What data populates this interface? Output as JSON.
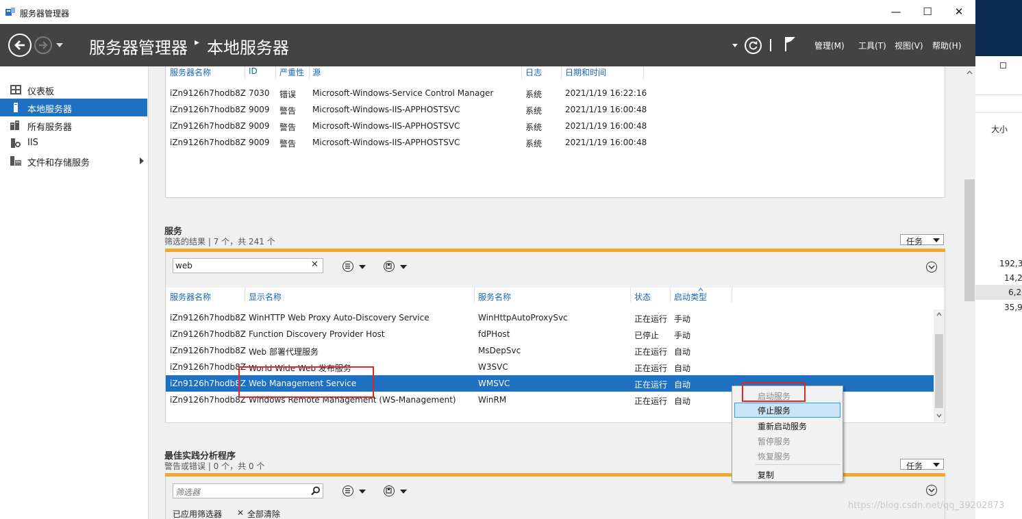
{
  "window": {
    "title": "服务器管理器",
    "minimize": "—",
    "maximize": "☐",
    "close": "✕"
  },
  "header": {
    "breadcrumb_root": "服务器管理器",
    "breadcrumb_sep": "▸",
    "breadcrumb_current": "本地服务器",
    "menus": [
      "管理(M)",
      "工具(T)",
      "视图(V)",
      "帮助(H)"
    ]
  },
  "sidebar": {
    "items": [
      {
        "label": "仪表板",
        "icon": "dashboard-icon"
      },
      {
        "label": "本地服务器",
        "icon": "server-icon",
        "active": true
      },
      {
        "label": "所有服务器",
        "icon": "servers-icon"
      },
      {
        "label": "IIS",
        "icon": "iis-icon"
      },
      {
        "label": "文件和存储服务",
        "icon": "storage-icon",
        "has_arrow": true
      }
    ]
  },
  "events": {
    "columns": [
      "服务器名称",
      "ID",
      "严重性",
      "源",
      "日志",
      "日期和时间"
    ],
    "rows": [
      [
        "iZn9126h7hodb8Z",
        "7030",
        "错误",
        "Microsoft-Windows-Service Control Manager",
        "系统",
        "2021/1/19 16:22:16"
      ],
      [
        "iZn9126h7hodb8Z",
        "9009",
        "警告",
        "Microsoft-Windows-IIS-APPHOSTSVC",
        "系统",
        "2021/1/19 16:00:48"
      ],
      [
        "iZn9126h7hodb8Z",
        "9009",
        "警告",
        "Microsoft-Windows-IIS-APPHOSTSVC",
        "系统",
        "2021/1/19 16:00:48"
      ],
      [
        "iZn9126h7hodb8Z",
        "9009",
        "警告",
        "Microsoft-Windows-IIS-APPHOSTSVC",
        "系统",
        "2021/1/19 16:00:48"
      ]
    ]
  },
  "services": {
    "title": "服务",
    "subtitle": "筛选的结果 | 7 个，共 241 个",
    "task_label": "任务",
    "search_value": "web",
    "columns": [
      "服务器名称",
      "显示名称",
      "服务名称",
      "状态",
      "启动类型"
    ],
    "rows": [
      [
        "iZn9126h7hodb8Z",
        "WinHTTP Web Proxy Auto-Discovery Service",
        "WinHttpAutoProxySvc",
        "正在运行",
        "手动"
      ],
      [
        "iZn9126h7hodb8Z",
        "Function Discovery Provider Host",
        "fdPHost",
        "已停止",
        "手动"
      ],
      [
        "iZn9126h7hodb8Z",
        "Web 部署代理服务",
        "MsDepSvc",
        "正在运行",
        "自动"
      ],
      [
        "iZn9126h7hodb8Z",
        "World Wide Web 发布服务",
        "W3SVC",
        "正在运行",
        "自动"
      ],
      [
        "iZn9126h7hodb8Z",
        "Web Management Service",
        "WMSVC",
        "正在运行",
        "自动"
      ],
      [
        "iZn9126h7hodb8Z",
        "Windows Remote Management (WS-Management)",
        "WinRM",
        "正在运行",
        "自动"
      ]
    ],
    "selected_row": 4
  },
  "context_menu": {
    "items": [
      {
        "label": "启动服务",
        "disabled": true
      },
      {
        "label": "停止服务",
        "highlighted": true
      },
      {
        "label": "重新启动服务"
      },
      {
        "label": "暂停服务",
        "disabled": true
      },
      {
        "label": "恢复服务",
        "disabled": true
      },
      {
        "label": "复制"
      }
    ]
  },
  "bpa": {
    "title": "最佳实践分析程序",
    "subtitle": "警告或错误 | 0 个，共 0 个",
    "task_label": "任务",
    "search_placeholder": "筛选器",
    "applied_filter": "已应用筛选器",
    "clear_all": "全部清除"
  },
  "right_window": {
    "size_label": "大小",
    "values": [
      "192,3",
      "14,2",
      "6,2",
      "35,9"
    ]
  },
  "watermark": "https://blog.csdn.net/qq_39202873",
  "colors": {
    "accent": "#1e70c1",
    "header_bg": "#434343",
    "orange": "#f4a72d",
    "highlight_box": "#e52424"
  }
}
